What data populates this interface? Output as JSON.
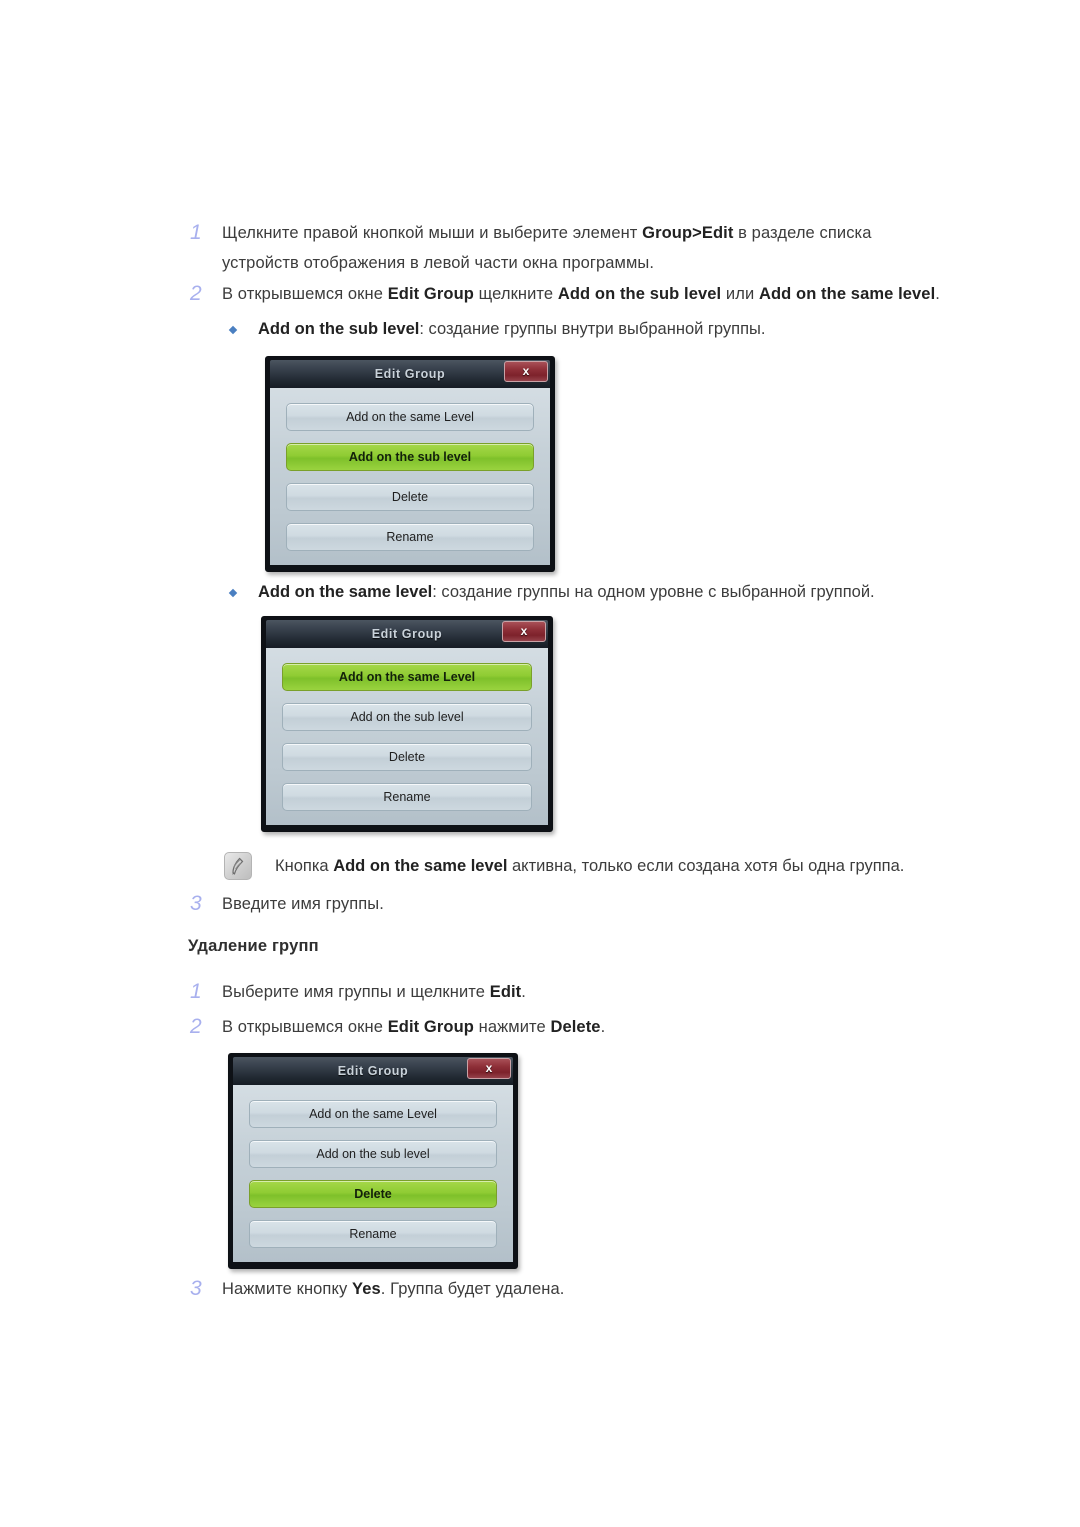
{
  "steps_add": [
    {
      "num": "1",
      "parts": [
        {
          "t": "Щелкните правой кнопкой мыши и выберите элемент ",
          "b": false
        },
        {
          "t": "Group>Edit",
          "b": true
        },
        {
          "t": " в разделе списка устройств отображения в левой части окна программы.",
          "b": false
        }
      ]
    },
    {
      "num": "2",
      "parts": [
        {
          "t": "В открывшемся окне ",
          "b": false
        },
        {
          "t": "Edit Group",
          "b": true
        },
        {
          "t": " щелкните ",
          "b": false
        },
        {
          "t": "Add on the sub level",
          "b": true
        },
        {
          "t": " или ",
          "b": false
        },
        {
          "t": "Add on the same level",
          "b": true
        },
        {
          "t": ".",
          "b": false
        }
      ]
    },
    {
      "num": "3",
      "parts": [
        {
          "t": "Введите имя группы.",
          "b": false
        }
      ]
    }
  ],
  "bullets": [
    {
      "parts": [
        {
          "t": "Add on the sub level",
          "b": true
        },
        {
          "t": ": создание группы внутри выбранной группы.",
          "b": false
        }
      ]
    },
    {
      "parts": [
        {
          "t": "Add on the same level",
          "b": true
        },
        {
          "t": ": создание группы на одном уровне с выбранной группой.",
          "b": false
        }
      ]
    }
  ],
  "note": {
    "icon": "note-pencil-icon",
    "parts": [
      {
        "t": "Кнопка ",
        "b": false
      },
      {
        "t": "Add on the same level",
        "b": true
      },
      {
        "t": " активна, только если создана хотя бы одна группа.",
        "b": false
      }
    ]
  },
  "section_heading": "Удаление групп",
  "steps_delete": [
    {
      "num": "1",
      "parts": [
        {
          "t": "Выберите имя группы и щелкните ",
          "b": false
        },
        {
          "t": "Edit",
          "b": true
        },
        {
          "t": ".",
          "b": false
        }
      ]
    },
    {
      "num": "2",
      "parts": [
        {
          "t": "В открывшемся окне ",
          "b": false
        },
        {
          "t": "Edit Group",
          "b": true
        },
        {
          "t": " нажмите ",
          "b": false
        },
        {
          "t": "Delete",
          "b": true
        },
        {
          "t": ".",
          "b": false
        }
      ]
    },
    {
      "num": "3",
      "parts": [
        {
          "t": "Нажмите кнопку ",
          "b": false
        },
        {
          "t": "Yes",
          "b": true
        },
        {
          "t": ". Группа будет удалена.",
          "b": false
        }
      ]
    }
  ],
  "dialogs": [
    {
      "title": "Edit Group",
      "close_label": "x",
      "selected": "Add on the sub level",
      "buttons": [
        {
          "label": "Add on the same Level",
          "selected": false
        },
        {
          "label": "Add on the sub level",
          "selected": true
        },
        {
          "label": "Delete",
          "selected": false
        },
        {
          "label": "Rename",
          "selected": false
        }
      ]
    },
    {
      "title": "Edit Group",
      "close_label": "x",
      "selected": "Add on the same Level",
      "buttons": [
        {
          "label": "Add on the same Level",
          "selected": true
        },
        {
          "label": "Add on the sub level",
          "selected": false
        },
        {
          "label": "Delete",
          "selected": false
        },
        {
          "label": "Rename",
          "selected": false
        }
      ]
    },
    {
      "title": "Edit Group",
      "close_label": "x",
      "selected": "Delete",
      "buttons": [
        {
          "label": "Add on the same Level",
          "selected": false
        },
        {
          "label": "Add on the sub level",
          "selected": false
        },
        {
          "label": "Delete",
          "selected": true
        },
        {
          "label": "Rename",
          "selected": false
        }
      ]
    }
  ],
  "colors": {
    "step_number": "#a8b0ee",
    "bullet": "#4a7fc1",
    "selected_button": "#8fcc33",
    "close_button": "#8e2f38",
    "titlebar": "#39424e",
    "dialog_body": "#c6d1d8",
    "text": "#3c3c3c"
  }
}
